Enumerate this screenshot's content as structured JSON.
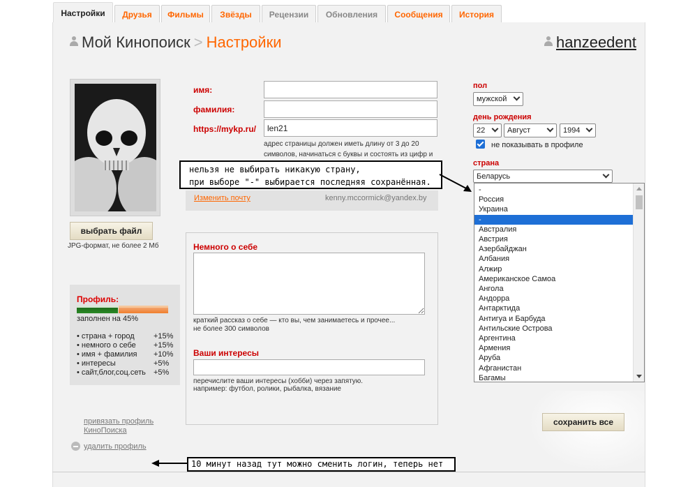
{
  "tabs": [
    {
      "label": "Настройки"
    },
    {
      "label": "Друзья"
    },
    {
      "label": "Фильмы"
    },
    {
      "label": "Звёзды"
    },
    {
      "label": "Рецензии"
    },
    {
      "label": "Обновления"
    },
    {
      "label": "Сообщения"
    },
    {
      "label": "История"
    }
  ],
  "header": {
    "breadcrumb_root": "Мой Кинопоиск",
    "breadcrumb_sep": ">",
    "breadcrumb_current": "Настройки",
    "username": "hanzeedent"
  },
  "avatar": {
    "choose_button": "выбрать файл",
    "hint": "JPG-формат, не более 2 Мб"
  },
  "form": {
    "first_name_label": "имя:",
    "first_name_value": "",
    "last_name_label": "фамилия:",
    "last_name_value": "",
    "url_label": "https://mykp.ru/",
    "url_value": "len21",
    "url_hint": "адрес страницы должен иметь длину от 3 до 20 символов, начинаться с буквы и состоять из цифр и латинских букв",
    "change_email_link": "Изменить почту",
    "email": "kenny.mccormick@yandex.by"
  },
  "about": {
    "label": "Немного о себе",
    "value": "",
    "hint1": "краткий рассказ о себе — кто вы, чем занимаетесь и прочее...",
    "hint2": "не более 300 символов",
    "interests_label": "Ваши интересы",
    "interests_value": "",
    "interests_hint1": "перечислите ваши интересы (хобби) через запятую.",
    "interests_hint2": "например: футбол, ролики, рыбалка, вязание"
  },
  "profile": {
    "header": "Профиль:",
    "completion_percent": 45,
    "completion_text": "заполнен на 45%",
    "items": [
      {
        "label": "• страна + город",
        "pct": "+15%"
      },
      {
        "label": "• немного о себе",
        "pct": "+15%"
      },
      {
        "label": "• имя + фамилия",
        "pct": "+10%"
      },
      {
        "label": "• интересы",
        "pct": "+5%"
      },
      {
        "label": "• сайт,блог,соц.сеть",
        "pct": "+5%"
      }
    ]
  },
  "links": {
    "bind_profile_line1": "привязать профиль",
    "bind_profile_line2": "КиноПоиска",
    "delete_profile": "удалить профиль"
  },
  "right": {
    "gender_label": "пол",
    "gender_value": "мужской",
    "birthday_label": "день рождения",
    "day": "22",
    "month": "Август",
    "year": "1994",
    "hide_in_profile": "не показывать в профиле",
    "hide_checked": true,
    "country_label": "страна",
    "country_value": "Беларусь",
    "country_options": [
      "-",
      "Россия",
      "Украина",
      "-",
      "Австралия",
      "Австрия",
      "Азербайджан",
      "Албания",
      "Алжир",
      "Американское Самоа",
      "Ангола",
      "Андорра",
      "Антарктида",
      "Антигуа и Барбуда",
      "Антильские Острова",
      "Аргентина",
      "Армения",
      "Аруба",
      "Афганистан",
      "Багамы"
    ],
    "country_highlighted_index": 3,
    "save_button": "сохранить все"
  },
  "annotations": {
    "callout1_line1": "нельзя не выбирать никакую страну,",
    "callout1_line2": "при выборе \"-\" выбирается последняя сохранённая.",
    "callout2": "10 минут назад тут можно сменить логин, теперь нет"
  },
  "colors": {
    "accent": "#ff6600",
    "label_red": "#cc0000",
    "progress_green": "#2a8a26",
    "progress_orange": "#f07e2c",
    "highlight": "#1e6fd6"
  }
}
